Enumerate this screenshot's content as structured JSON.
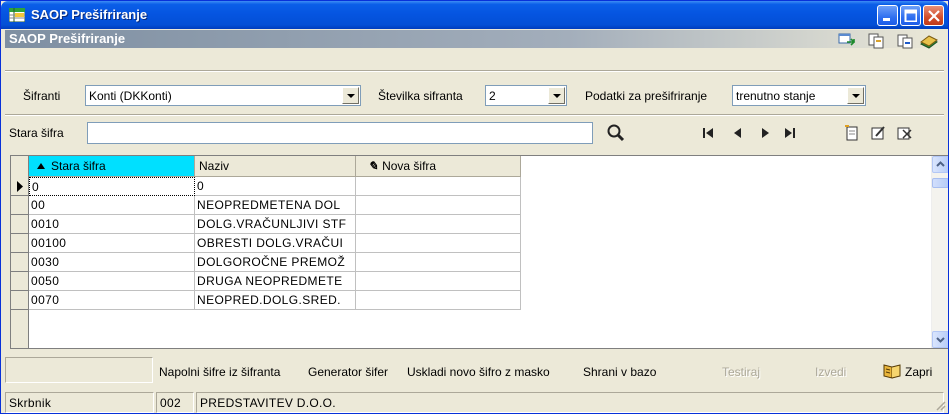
{
  "window": {
    "title": "SAOP Prešifriranje"
  },
  "banner": {
    "title": "SAOP Prešifriranje"
  },
  "filters": {
    "sifranti_label": "Šifranti",
    "sifranti_value": "Konti (DKKonti)",
    "stevilka_label": "Številka sifranta",
    "stevilka_value": "2",
    "podatki_label": "Podatki za prešifriranje",
    "podatki_value": "trenutno stanje"
  },
  "search": {
    "label": "Stara šifra",
    "value": ""
  },
  "grid": {
    "columns": [
      "Stara šifra",
      "Naziv",
      "Nova šifra"
    ],
    "rows": [
      {
        "stara": "0",
        "naziv": "0",
        "nova": ""
      },
      {
        "stara": "00",
        "naziv": "NEOPREDMETENA DOL",
        "nova": ""
      },
      {
        "stara": "0010",
        "naziv": "DOLG.VRAČUNLJIVI STF",
        "nova": ""
      },
      {
        "stara": "00100",
        "naziv": "OBRESTI DOLG.VRAČUI",
        "nova": ""
      },
      {
        "stara": "0030",
        "naziv": "DOLGOROČNE PREMOŽ",
        "nova": ""
      },
      {
        "stara": "0050",
        "naziv": "DRUGA NEOPREDMETE",
        "nova": ""
      },
      {
        "stara": "0070",
        "naziv": "NEOPRED.DOLG.SRED.",
        "nova": ""
      }
    ]
  },
  "actions": {
    "napolni": "Napolni šifre iz šifranta",
    "generator": "Generator šifer",
    "uskladi": "Uskladi novo šifro z masko",
    "shrani": "Shrani v bazo",
    "testiraj": "Testiraj",
    "izvedi": "Izvedi",
    "zapri": "Zapri"
  },
  "status": {
    "user": "Skrbnik",
    "code": "002",
    "company": "PREDSTAVITEV D.O.O."
  },
  "colors": {
    "titlebar": "#0554e0",
    "active_header": "#00e0ff",
    "face": "#ece9d8"
  }
}
